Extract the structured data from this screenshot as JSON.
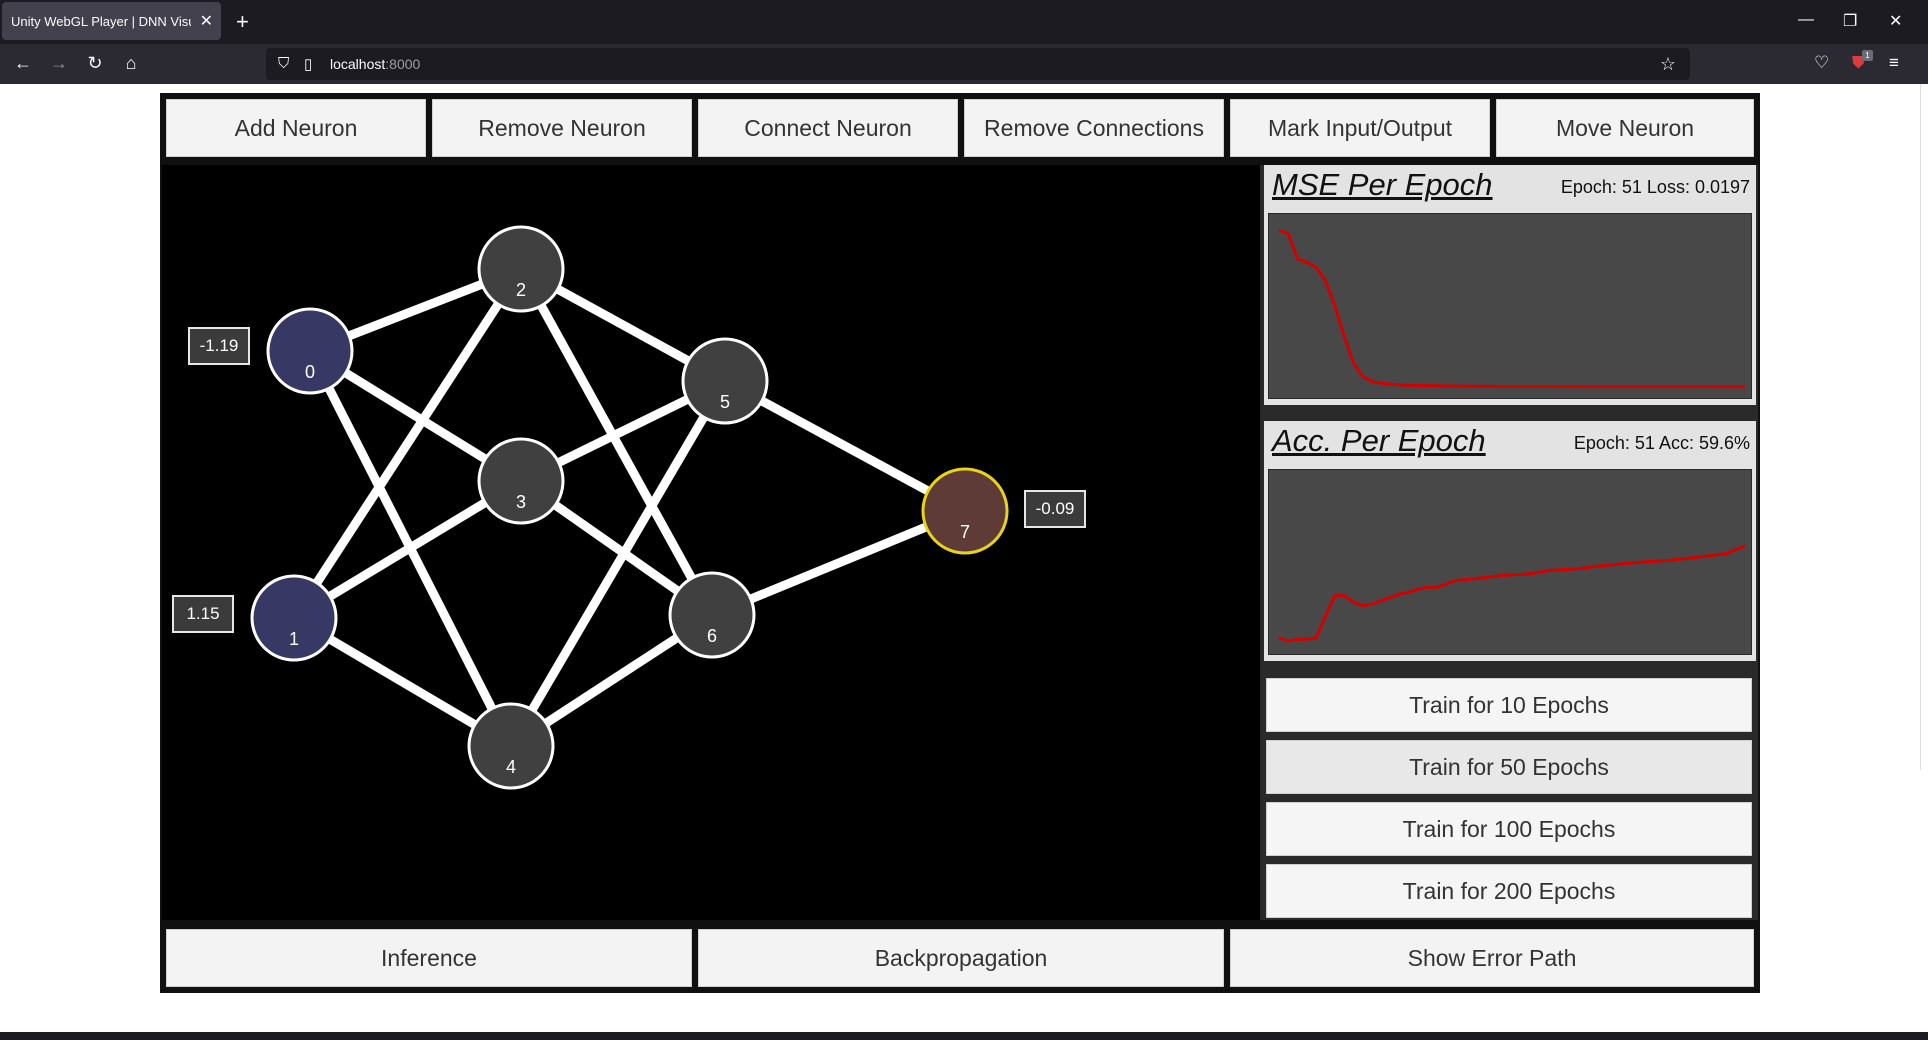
{
  "browser": {
    "tab_title": "Unity WebGL Player | DNN Visualizer",
    "tab_close": "✕",
    "new_tab": "+",
    "url_host": "localhost",
    "url_port": ":8000",
    "window_controls": [
      "—",
      "❐",
      "✕"
    ],
    "ext_badge": "1"
  },
  "toolbar": {
    "buttons": [
      "Add Neuron",
      "Remove Neuron",
      "Connect Neuron",
      "Remove Connections",
      "Mark Input/Output",
      "Move Neuron"
    ]
  },
  "network": {
    "neurons": [
      {
        "id": "0",
        "role": "input"
      },
      {
        "id": "1",
        "role": "input"
      },
      {
        "id": "2",
        "role": "hidden"
      },
      {
        "id": "3",
        "role": "hidden"
      },
      {
        "id": "4",
        "role": "hidden"
      },
      {
        "id": "5",
        "role": "hidden"
      },
      {
        "id": "6",
        "role": "hidden"
      },
      {
        "id": "7",
        "role": "output"
      }
    ],
    "connections": [
      [
        "0",
        "2"
      ],
      [
        "0",
        "3"
      ],
      [
        "0",
        "4"
      ],
      [
        "1",
        "2"
      ],
      [
        "1",
        "3"
      ],
      [
        "1",
        "4"
      ],
      [
        "2",
        "5"
      ],
      [
        "2",
        "6"
      ],
      [
        "3",
        "5"
      ],
      [
        "3",
        "6"
      ],
      [
        "4",
        "5"
      ],
      [
        "4",
        "6"
      ],
      [
        "5",
        "7"
      ],
      [
        "6",
        "7"
      ]
    ],
    "values": {
      "0": "-1.19",
      "1": "1.15",
      "7": "-0.09"
    },
    "colors": {
      "input": "#373964",
      "hidden": "#404040",
      "output": "#5e3b36",
      "output_ring": "#e8d21a",
      "edge": "#ffffff"
    }
  },
  "mse_panel": {
    "title": "MSE Per Epoch",
    "stat": "Epoch: 51 Loss: 0.0197"
  },
  "acc_panel": {
    "title": "Acc. Per Epoch",
    "stat": "Epoch: 51 Acc: 59.6%"
  },
  "chart_data": [
    {
      "type": "line",
      "title": "MSE Per Epoch",
      "x": [
        1,
        2,
        3,
        4,
        5,
        6,
        7,
        8,
        9,
        10,
        11,
        12,
        13,
        14,
        15,
        16,
        17,
        18,
        19,
        20,
        22,
        25,
        30,
        35,
        40,
        45,
        51
      ],
      "series": [
        {
          "values": [
            0.95,
            0.93,
            0.78,
            0.76,
            0.73,
            0.65,
            0.5,
            0.32,
            0.16,
            0.08,
            0.05,
            0.04,
            0.035,
            0.03,
            0.028,
            0.027,
            0.026,
            0.025,
            0.024,
            0.023,
            0.022,
            0.021,
            0.021,
            0.02,
            0.02,
            0.02,
            0.0197
          ]
        }
      ],
      "color": "#d40000"
    },
    {
      "type": "line",
      "title": "Acc. Per Epoch",
      "x": [
        1,
        2,
        3,
        4,
        5,
        6,
        7,
        8,
        9,
        10,
        11,
        12,
        13,
        14,
        15,
        16,
        17,
        18,
        19,
        20,
        22,
        25,
        28,
        30,
        33,
        36,
        40,
        43,
        46,
        49,
        51
      ],
      "series": [
        {
          "values": [
            5,
            3,
            4,
            4,
            5,
            18,
            30,
            30,
            26,
            24,
            25,
            27,
            29,
            31,
            32,
            34,
            35,
            35,
            37,
            39,
            40,
            42,
            43,
            45,
            46,
            48,
            50,
            51,
            53,
            55,
            59.6
          ]
        }
      ],
      "color": "#d40000"
    }
  ],
  "train_buttons": [
    "Train for 10 Epochs",
    "Train for 50 Epochs",
    "Train for 100 Epochs",
    "Train for 200 Epochs"
  ],
  "bottom_buttons": [
    "Inference",
    "Backpropagation",
    "Show Error Path"
  ]
}
